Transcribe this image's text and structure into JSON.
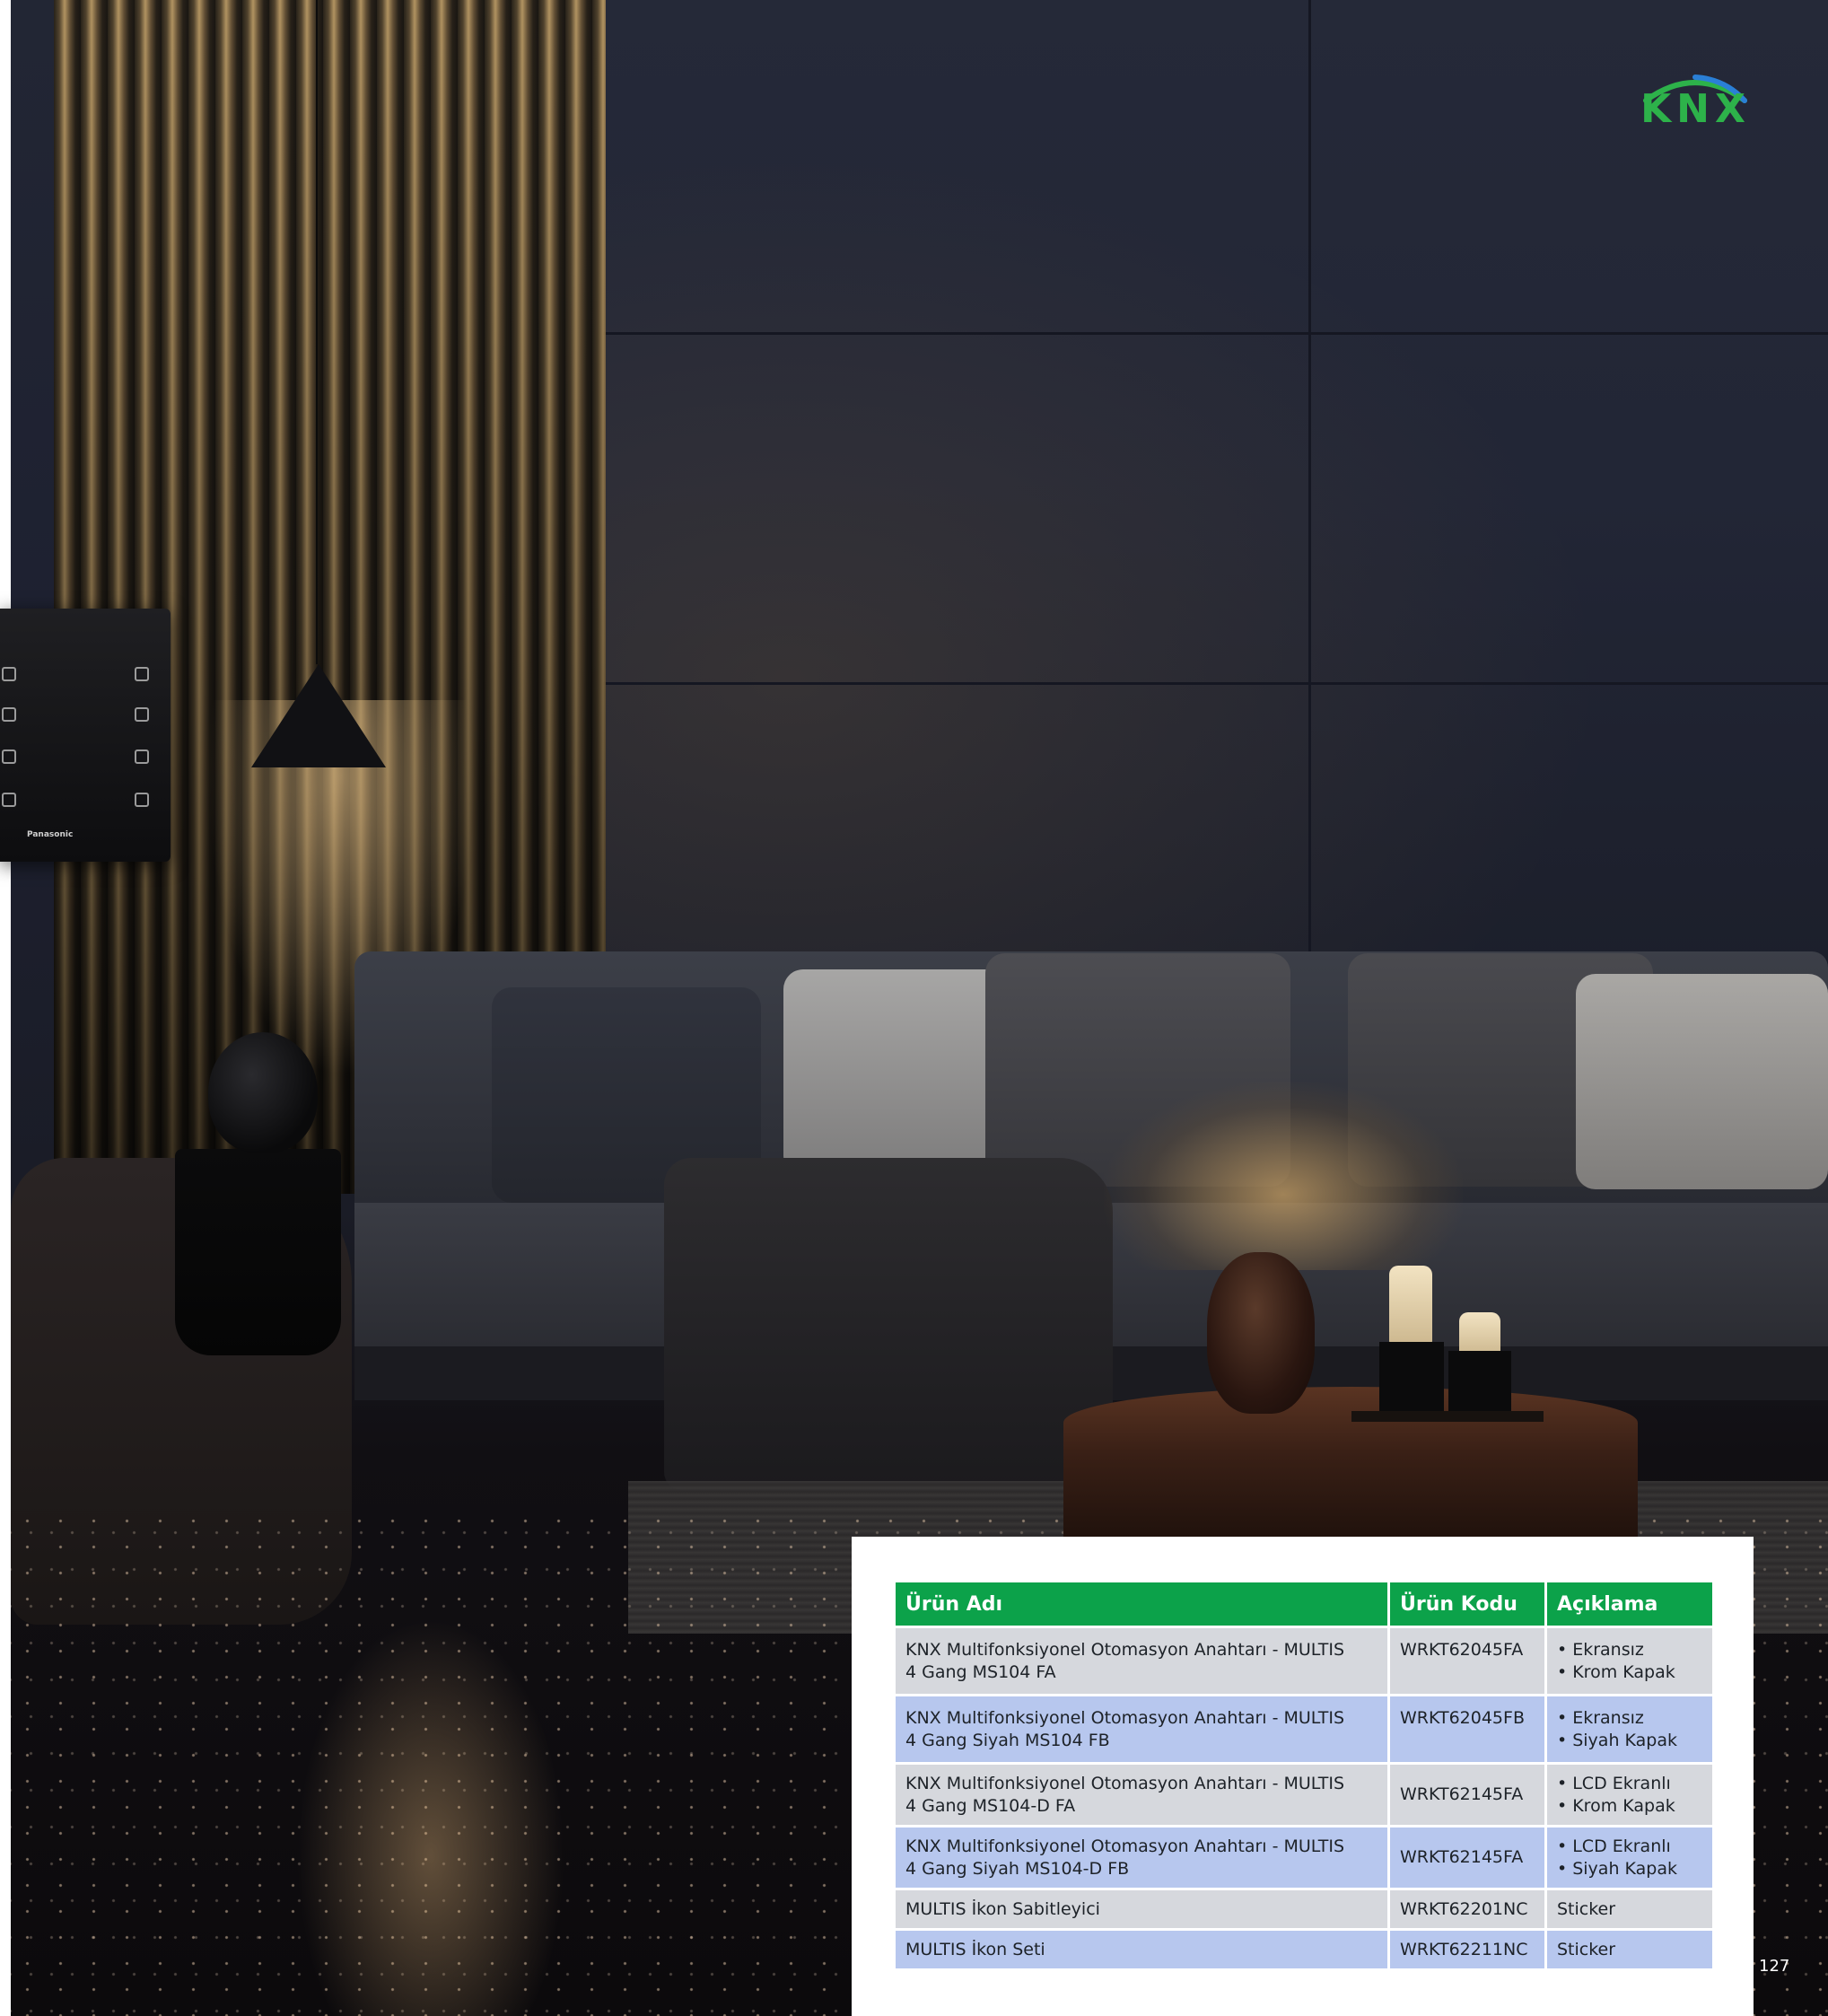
{
  "logo": {
    "text": "KNX",
    "colors": {
      "text": "#2db24a",
      "arc_left": "#2db24a",
      "arc_right": "#2a7fd6"
    }
  },
  "device_panel": {
    "brand": "Panasonic"
  },
  "product_table": {
    "headers": {
      "name": "Ürün Adı",
      "code": "Ürün Kodu",
      "description": "Açıklama"
    },
    "rows": [
      {
        "name_line1": "KNX Multifonksiyonel Otomasyon Anahtarı - MULTIS",
        "name_line2": "4 Gang MS104 FA",
        "code": "WRKT62045FA",
        "desc1": "Ekransız",
        "desc2": "Krom Kapak"
      },
      {
        "name_line1": "KNX Multifonksiyonel Otomasyon Anahtarı - MULTIS",
        "name_line2": "4 Gang Siyah MS104 FB",
        "code": "WRKT62045FB",
        "desc1": "Ekransız",
        "desc2": "Siyah Kapak"
      },
      {
        "name_line1": "KNX Multifonksiyonel Otomasyon Anahtarı - MULTIS",
        "name_line2": "4 Gang MS104-D FA",
        "code": "WRKT62145FA",
        "desc1": "LCD Ekranlı",
        "desc2": "Krom Kapak"
      },
      {
        "name_line1": "KNX Multifonksiyonel Otomasyon Anahtarı - MULTIS",
        "name_line2": "4 Gang Siyah MS104-D FB",
        "code": "WRKT62145FA",
        "desc1": "LCD Ekranlı",
        "desc2": "Siyah Kapak"
      },
      {
        "name": "MULTIS İkon Sabitleyici",
        "code": "WRKT62201NC",
        "description": "Sticker"
      },
      {
        "name": "MULTIS İkon Seti",
        "code": "WRKT62211NC",
        "description": "Sticker"
      }
    ],
    "colors": {
      "header": "#0ca24a",
      "row_gray": "#d6d8dd",
      "row_blue": "#b7c7ee"
    }
  },
  "page_number": "127"
}
